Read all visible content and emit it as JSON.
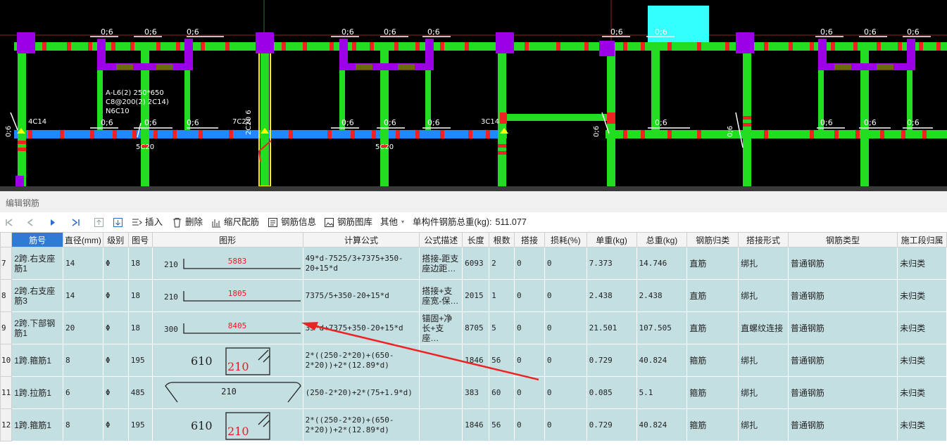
{
  "cad": {
    "labels": [
      "0;6",
      "0;6",
      "0;6",
      "0;6",
      "0;6",
      "0;6",
      "0;6",
      "0;6",
      "0;6",
      "0;6",
      "0;6",
      "0;6"
    ],
    "side_label": "0;6",
    "beam_annotation": [
      "A-L6(2) 250*650",
      "C8@200(2) 2C14)",
      "N6C10"
    ],
    "col_label_1": "4C14",
    "col_label_2": "7C22",
    "col_label_3": "2C20 6",
    "col_label_4": "3C14",
    "mid_label": "5C20",
    "mid_label_2": "5C20"
  },
  "panel": {
    "title": "编辑钢筋"
  },
  "toolbar": {
    "insert": "插入",
    "delete": "删除",
    "scale": "缩尺配筋",
    "info": "钢筋信息",
    "library": "钢筋图库",
    "other": "其他",
    "total_label": "单构件钢筋总重(kg):",
    "total_value": "511.077"
  },
  "table": {
    "headers": [
      "筋号",
      "直径(mm)",
      "级别",
      "图号",
      "图形",
      "计算公式",
      "公式描述",
      "长度",
      "根数",
      "搭接",
      "损耗(%)",
      "单重(kg)",
      "总重(kg)",
      "钢筋归类",
      "搭接形式",
      "钢筋类型",
      "施工段归属"
    ],
    "rows": [
      {
        "num": "7",
        "name": "2跨.右支座筋1",
        "dia": "14",
        "grade": "Φ",
        "fig": "18",
        "shape_left": "210",
        "shape_value": "5883",
        "formula": "49*d-7525/3+7375+350-20+15*d",
        "desc": "搭接-距支座边距…",
        "length": "6093",
        "count": "2",
        "lap": "0",
        "loss": "0",
        "unit": "7.373",
        "total": "14.746",
        "cat": "直筋",
        "lap_form": "绑扎",
        "type": "普通钢筋",
        "stage": "未归类"
      },
      {
        "num": "8",
        "name": "2跨.右支座筋3",
        "dia": "14",
        "grade": "Φ",
        "fig": "18",
        "shape_left": "210",
        "shape_value": "1805",
        "formula": "7375/5+350-20+15*d",
        "desc": "搭接+支座宽-保…",
        "length": "2015",
        "count": "1",
        "lap": "0",
        "loss": "0",
        "unit": "2.438",
        "total": "2.438",
        "cat": "直筋",
        "lap_form": "绑扎",
        "type": "普通钢筋",
        "stage": "未归类"
      },
      {
        "num": "9",
        "name": "2跨.下部钢筋1",
        "dia": "20",
        "grade": "Φ",
        "fig": "18",
        "shape_left": "300",
        "shape_value": "8405",
        "formula": "35*d+7375+350-20+15*d",
        "desc": "锚固+净长+支座…",
        "length": "8705",
        "count": "5",
        "lap": "0",
        "loss": "0",
        "unit": "21.501",
        "total": "107.505",
        "cat": "直筋",
        "lap_form": "直螺纹连接",
        "type": "普通钢筋",
        "stage": "未归类"
      },
      {
        "num": "10",
        "name": "1跨.箍筋1",
        "dia": "8",
        "grade": "Φ",
        "fig": "195",
        "shape_left": "610",
        "shape_value": "210",
        "formula": "2*((250-2*20)+(650-2*20))+2*(12.89*d)",
        "desc": "",
        "length": "1846",
        "count": "56",
        "lap": "0",
        "loss": "0",
        "unit": "0.729",
        "total": "40.824",
        "cat": "箍筋",
        "lap_form": "绑扎",
        "type": "普通钢筋",
        "stage": "未归类"
      },
      {
        "num": "11",
        "name": "1跨.拉筋1",
        "dia": "6",
        "grade": "Φ",
        "fig": "485",
        "shape_left": "",
        "shape_value": "210",
        "formula": "(250-2*20)+2*(75+1.9*d)",
        "desc": "",
        "length": "383",
        "count": "60",
        "lap": "0",
        "loss": "0",
        "unit": "0.085",
        "total": "5.1",
        "cat": "箍筋",
        "lap_form": "绑扎",
        "type": "普通钢筋",
        "stage": "未归类"
      },
      {
        "num": "12",
        "name": "1跨.箍筋1",
        "dia": "8",
        "grade": "Φ",
        "fig": "195",
        "shape_left": "610",
        "shape_value": "210",
        "formula": "2*((250-2*20)+(650-2*20))+2*(12.89*d)",
        "desc": "",
        "length": "1846",
        "count": "56",
        "lap": "0",
        "loss": "0",
        "unit": "0.729",
        "total": "40.824",
        "cat": "箍筋",
        "lap_form": "绑扎",
        "type": "普通钢筋",
        "stage": "未归类"
      }
    ]
  },
  "colors": {
    "accent": "#2f7ad4",
    "row_bg": "#c4dfe2",
    "rebar_green": "#22dd22",
    "column_purple": "#9b00e6",
    "beam_blue": "#2288ff",
    "arrow": "#ee2222"
  }
}
